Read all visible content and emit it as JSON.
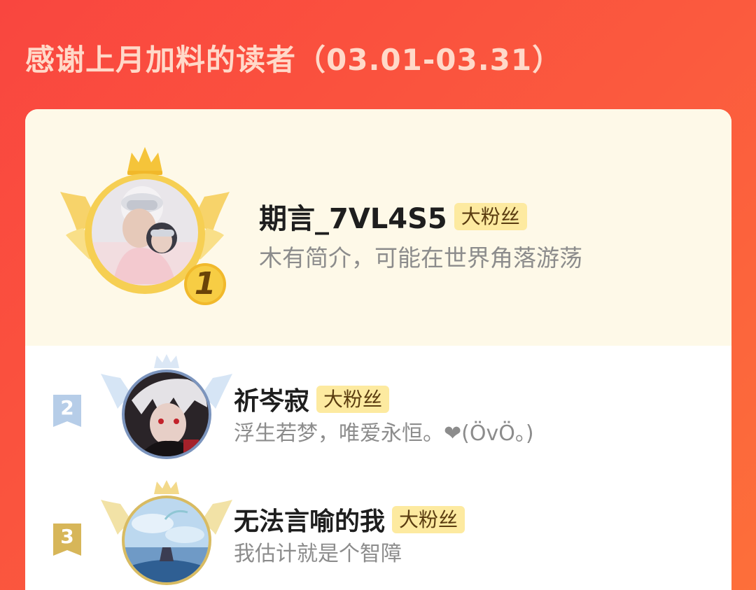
{
  "header": {
    "title": "感谢上月加料的读者（03.01-03.31）"
  },
  "readers": [
    {
      "rank": "1",
      "name": "期言_7VL4S5",
      "tag": "大粉丝",
      "bio": "木有简介，可能在世界角落游荡",
      "avatar_icon": "avatar-anime-girls-icon"
    },
    {
      "rank": "2",
      "name": "祈岑寂",
      "tag": "大粉丝",
      "bio": "浮生若梦，唯爱永恒。❤(ÖvÖ。)",
      "avatar_icon": "avatar-anime-boy-icon"
    },
    {
      "rank": "3",
      "name": "无法言喻的我",
      "tag": "大粉丝",
      "bio": "我估计就是个智障",
      "avatar_icon": "avatar-sky-scene-icon"
    }
  ],
  "colors": {
    "background_start": "#f9463f",
    "background_end": "#fd6f3a",
    "gold": "#f5c43a",
    "silver": "#a9c4e6",
    "bronze": "#d9b55a",
    "fan_tag_bg": "#fdeaa0"
  }
}
